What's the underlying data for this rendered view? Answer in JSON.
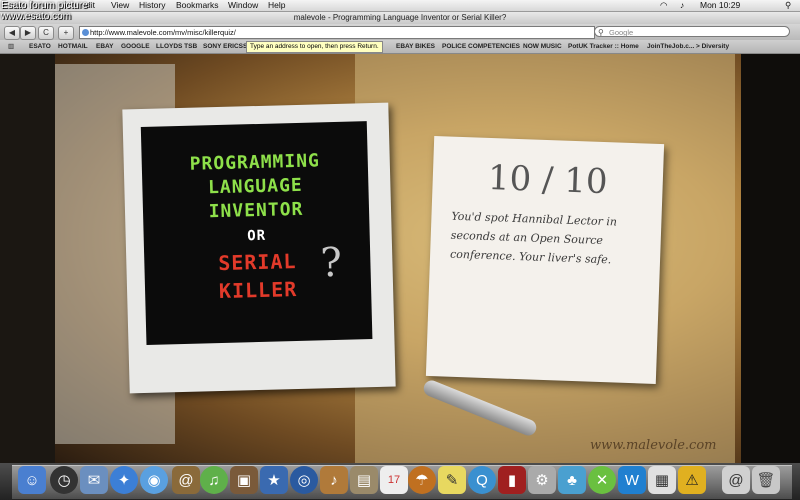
{
  "overlay": {
    "line1": "Esato forum picture",
    "line2": "www.esato.com"
  },
  "menubar": {
    "items": [
      "dit",
      "View",
      "History",
      "Bookmarks",
      "Window",
      "Help"
    ],
    "clock": "Mon 10:29"
  },
  "window": {
    "title": "malevole - Programming Language Inventor or Serial Killer?"
  },
  "toolbar": {
    "back": "◀",
    "forward": "▶",
    "reload": "C",
    "add": "+",
    "url": "http://www.malevole.com/mv/misc/killerquiz/",
    "search_placeholder": "Google"
  },
  "tooltip": "Type an address to open, then press Return.",
  "bookmarks": [
    "ESATO",
    "HOTMAIL",
    "EBAY",
    "GOOGLE",
    "LLOYDS TSB",
    "SONY ERICSSO",
    "EBAY BIKES",
    "POLICE COMPETENCIES",
    "NOW MUSIC",
    "PotUK Tracker :: Home",
    "JoinTheJob.c...",
    "> Diversity"
  ],
  "page": {
    "title_line1": "PROGRAMMING",
    "title_line2": "LANGUAGE",
    "title_line3": "INVENTOR",
    "or": "OR",
    "serial": "SERIAL",
    "killer": "KILLER",
    "qmark": "?",
    "score": "10 / 10",
    "verdict": "You'd spot Hannibal Lector in seconds at an Open Source conference. Your liver's safe.",
    "site": "www.malevole.com"
  },
  "colors": {
    "green": "#8ee04a",
    "red": "#e23a2a"
  },
  "dock": [
    "finder-icon",
    "dashboard-icon",
    "mail-icon",
    "safari-icon",
    "ichat-icon",
    "addressbook-icon",
    "itunes-icon",
    "iphoto-icon",
    "imovie-icon",
    "dvd-icon",
    "garageband-icon",
    "ical-icon",
    "preview-icon",
    "stickies-icon",
    "quicktime-icon",
    "photobooth-icon",
    "systemprefs-icon",
    "msn-icon",
    "xbox-icon",
    "wii-icon",
    "warning-icon",
    "itunes-app-icon",
    "trash-icon"
  ]
}
